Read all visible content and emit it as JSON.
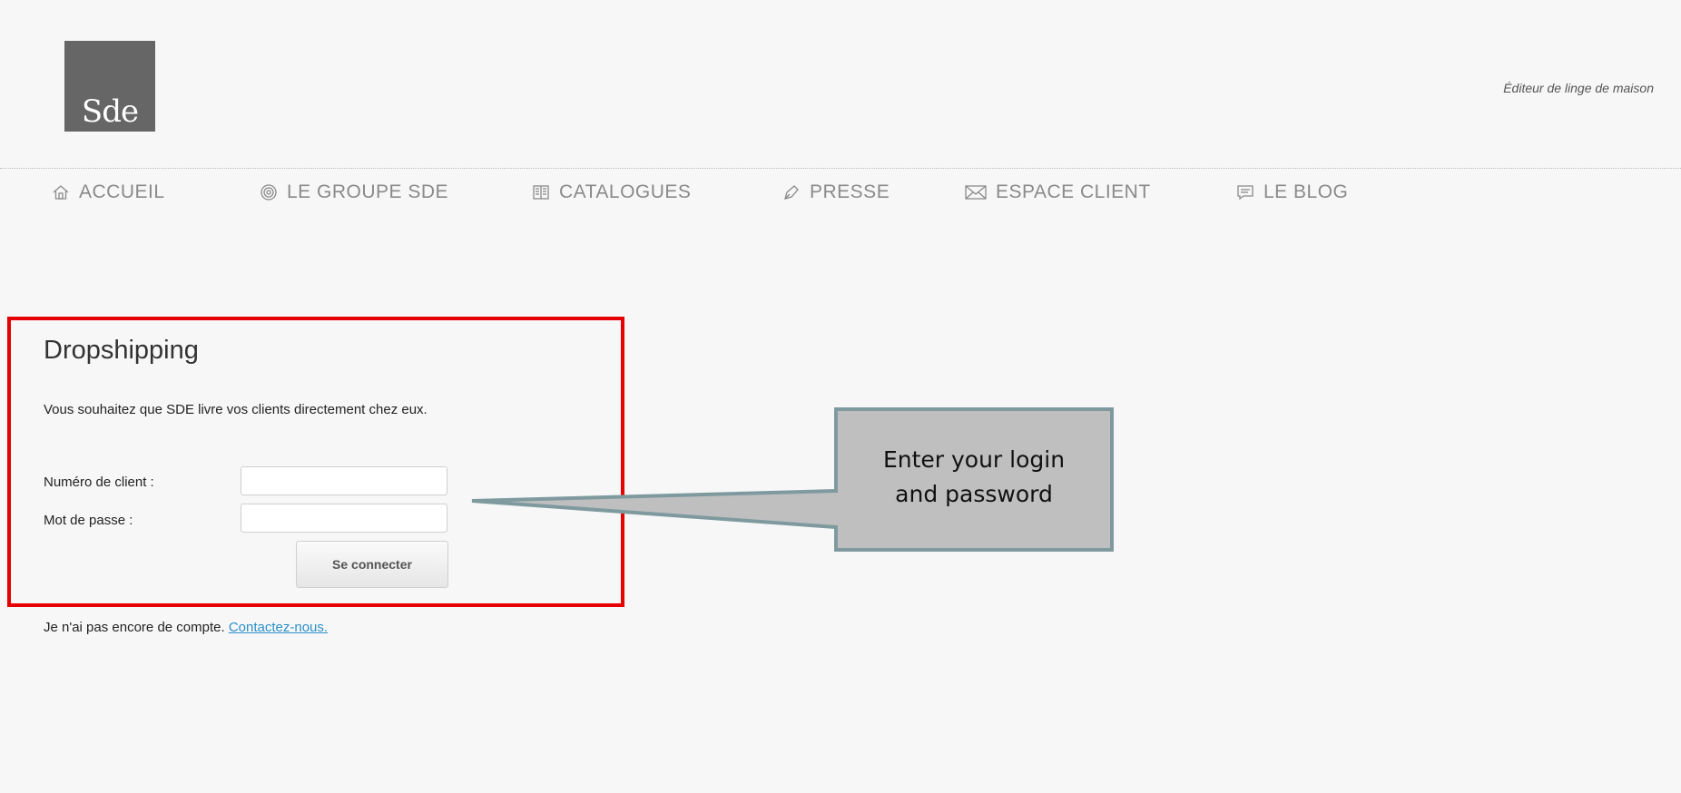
{
  "header": {
    "logo_text": "Sde",
    "tagline": "Éditeur de linge de maison"
  },
  "nav": {
    "items": [
      {
        "label": "ACCUEIL",
        "icon": "home-icon"
      },
      {
        "label": "LE GROUPE SDE",
        "icon": "target-icon"
      },
      {
        "label": "CATALOGUES",
        "icon": "book-icon"
      },
      {
        "label": "PRESSE",
        "icon": "pen-icon"
      },
      {
        "label": "ESPACE CLIENT",
        "icon": "envelope-icon"
      },
      {
        "label": "LE BLOG",
        "icon": "chat-icon"
      }
    ]
  },
  "main": {
    "title": "Dropshipping",
    "intro": "Vous souhaitez que SDE livre vos clients directement chez eux.",
    "form": {
      "client_label": "Numéro de client :",
      "client_value": "",
      "password_label": "Mot de passe :",
      "password_value": "",
      "submit_label": "Se connecter"
    },
    "signup": {
      "text": "Je n'ai pas encore de compte.",
      "link": "Contactez-nous."
    }
  },
  "annotation": {
    "callout_line1": "Enter your login",
    "callout_line2": "and password"
  },
  "colors": {
    "highlight": "#e60000",
    "callout_fill": "#bfbfbf",
    "callout_border": "#7f9a9f",
    "link": "#2a8fc9",
    "logo_bg": "#666666"
  }
}
